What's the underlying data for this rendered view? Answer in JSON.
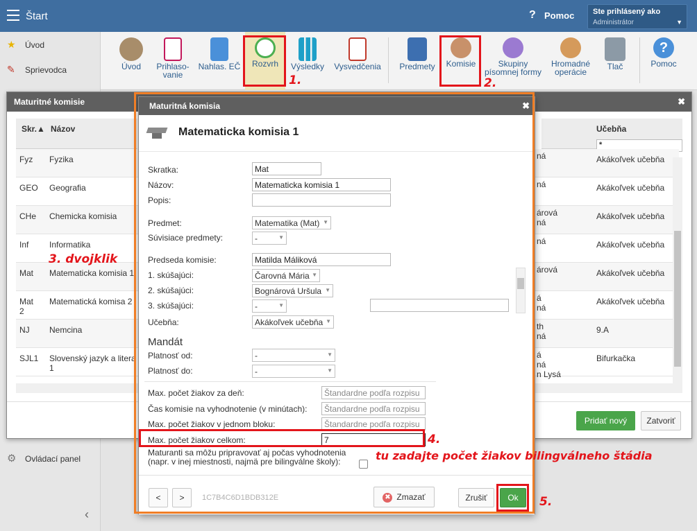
{
  "app": {
    "title": "Štart",
    "help_label": "Pomoc",
    "user_label": "Ste prihlásený ako",
    "user_name": "Administrátor"
  },
  "sidebar": {
    "items": [
      {
        "label": "Úvod"
      },
      {
        "label": "Sprievodca"
      },
      {
        "label": "Ovládací panel"
      }
    ]
  },
  "toolbar": {
    "items": [
      {
        "label": "Úvod"
      },
      {
        "label": "Prihlaso-\nvanie"
      },
      {
        "label": "Nahlas. EČ"
      },
      {
        "label": "Rozvrh"
      },
      {
        "label": "Výsledky"
      },
      {
        "label": "Vysvedčenia"
      },
      {
        "label": "Predmety"
      },
      {
        "label": "Komisie"
      },
      {
        "label": "Skupiny\npísomnej formy"
      },
      {
        "label": "Hromadné\noperácie"
      },
      {
        "label": "Tlač"
      },
      {
        "label": "Pomoc"
      }
    ]
  },
  "back_dialog": {
    "title": "Maturitné komisie",
    "columns": {
      "abbr": "Skr.",
      "name": "Názov",
      "room": "Učebňa",
      "room_filter": "*"
    },
    "rows": [
      {
        "abbr": "Fyz",
        "name": "Fyzika",
        "extra": "ná",
        "room": "Akákoľvek učebňa"
      },
      {
        "abbr": "GEO",
        "name": "Geografia",
        "extra": "ná",
        "room": "Akákoľvek učebňa"
      },
      {
        "abbr": "CHe",
        "name": "Chemicka komisia",
        "extra": "árová\nná",
        "room": "Akákoľvek učebňa"
      },
      {
        "abbr": "Inf",
        "name": "Informatika",
        "extra": "ná",
        "room": "Akákoľvek učebňa"
      },
      {
        "abbr": "Mat",
        "name": "Matematicka komisia 1",
        "extra": "árová",
        "room": "Akákoľvek učebňa"
      },
      {
        "abbr": "Mat\n2",
        "name": "Matematická komisa 2",
        "extra": "á\nná",
        "room": "Akákoľvek učebňa"
      },
      {
        "abbr": "NJ",
        "name": "Nemcina",
        "extra": "th\nná",
        "room": "9.A"
      },
      {
        "abbr": "SJL1",
        "name": "Slovenský jazyk a litera\n1",
        "extra": "á\nná\nn Lysá",
        "room": "Bifurkačka"
      }
    ],
    "add_button": "Pridať nový",
    "close_button": "Zatvoriť"
  },
  "front_dialog": {
    "title": "Maturitná komisia",
    "heading": "Matematicka komisia 1",
    "fields": {
      "skratka_label": "Skratka:",
      "skratka": "Mat",
      "nazov_label": "Názov:",
      "nazov": "Matematicka komisia 1",
      "popis_label": "Popis:",
      "popis": "",
      "predmet_label": "Predmet:",
      "predmet": "Matematika (Mat)",
      "suvisiace_label": "Súvisiace predmety:",
      "suvisiace": "-",
      "predseda_label": "Predseda komisie:",
      "predseda": "Matilda Máliková",
      "s1_label": "1. skúšajúci:",
      "s1": "Čarovná Mária",
      "s2_label": "2. skúšajúci:",
      "s2": "Bognárová Uršula",
      "s3_label": "3. skúšajúci:",
      "s3": "-",
      "ucebna_label": "Učebňa:",
      "ucebna": "Akákoľvek učebňa",
      "mandat_heading": "Mandát",
      "od_label": "Platnosť od:",
      "od": "-",
      "do_label": "Platnosť do:",
      "do": "-",
      "max_den_label": "Max. počet žiakov za deň:",
      "max_den_ph": "Štandardne podľa rozpisu",
      "cas_label": "Čas komisie na vyhodnotenie (v minútach):",
      "cas_ph": "Štandardne podľa rozpisu",
      "max_blok_label": "Max. počet žiakov v jednom bloku:",
      "max_blok_ph": "Štandardne podľa rozpisu",
      "max_celkom_label": "Max. počet žiakov celkom:",
      "max_celkom": "7",
      "maturanti_label": "Maturanti sa môžu pripravovať aj počas vyhodnotenia\n(napr. v inej miestnosti, najmä pre bilingválne školy):"
    },
    "footer": {
      "prev": "<",
      "next": ">",
      "id": "1C7B4C6D1BDB312E",
      "delete": "Zmazať",
      "cancel": "Zrušiť",
      "ok": "Ok"
    }
  },
  "annotations": {
    "n1": "1.",
    "n2": "2.",
    "n3": "3. dvojklik",
    "n4": "4.",
    "n4_text": "tu zadajte počet žiakov bilingválneho štádia",
    "n5": "5."
  }
}
